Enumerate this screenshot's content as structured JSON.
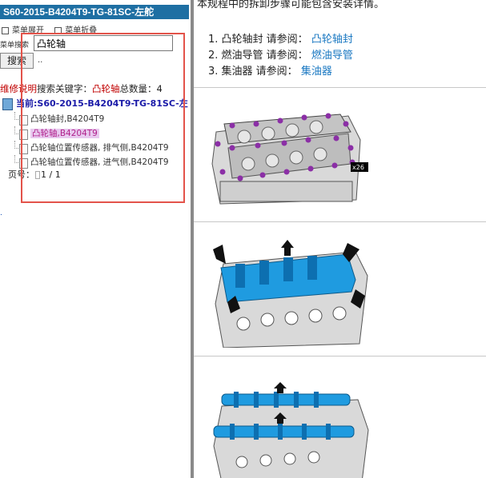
{
  "left": {
    "title": "S60-2015-B4204T9-TG-81SC-左舵",
    "menu_expand": "菜单展开",
    "menu_collapse": "菜单折叠",
    "search_label": "菜单搜索",
    "search_value": "凸轮轴",
    "search_button": "搜索",
    "dots": "..",
    "summary": {
      "repair_label": "维修说明",
      "keyword_label": "搜索关键字：",
      "keyword": "凸轮轴",
      "total_label": "总数量：4"
    },
    "current": {
      "label": "当前:",
      "value": "S60-2015-B4204T9-TG-81SC-左"
    },
    "items": [
      {
        "label": "凸轮轴封,B4204T9"
      },
      {
        "label": "凸轮轴,B4204T9"
      },
      {
        "label": "凸轮轴位置传感器, 排气侧,B4204T9"
      },
      {
        "label": "凸轮轴位置传感器, 进气侧,B4204T9"
      }
    ],
    "pager": {
      "label": "页号：",
      "value": "1 / 1"
    }
  },
  "right": {
    "intro": "本规程中的拆卸步骤可能包含安装详情。",
    "steps": [
      {
        "num": "1.",
        "text": "凸轮轴封 请参阅：",
        "link": "凸轮轴封"
      },
      {
        "num": "2.",
        "text": "燃油导管 请参阅：",
        "link": "燃油导管"
      },
      {
        "num": "3.",
        "text": "集油器 请参阅：",
        "link": "集油器"
      }
    ],
    "figure1_callout": "x26"
  },
  "colors": {
    "title_bg": "#1e6fa3",
    "highlight_blue": "#1f9be0",
    "bolt_purple": "#8b2fa6",
    "annotation_red": "#e3534a"
  }
}
